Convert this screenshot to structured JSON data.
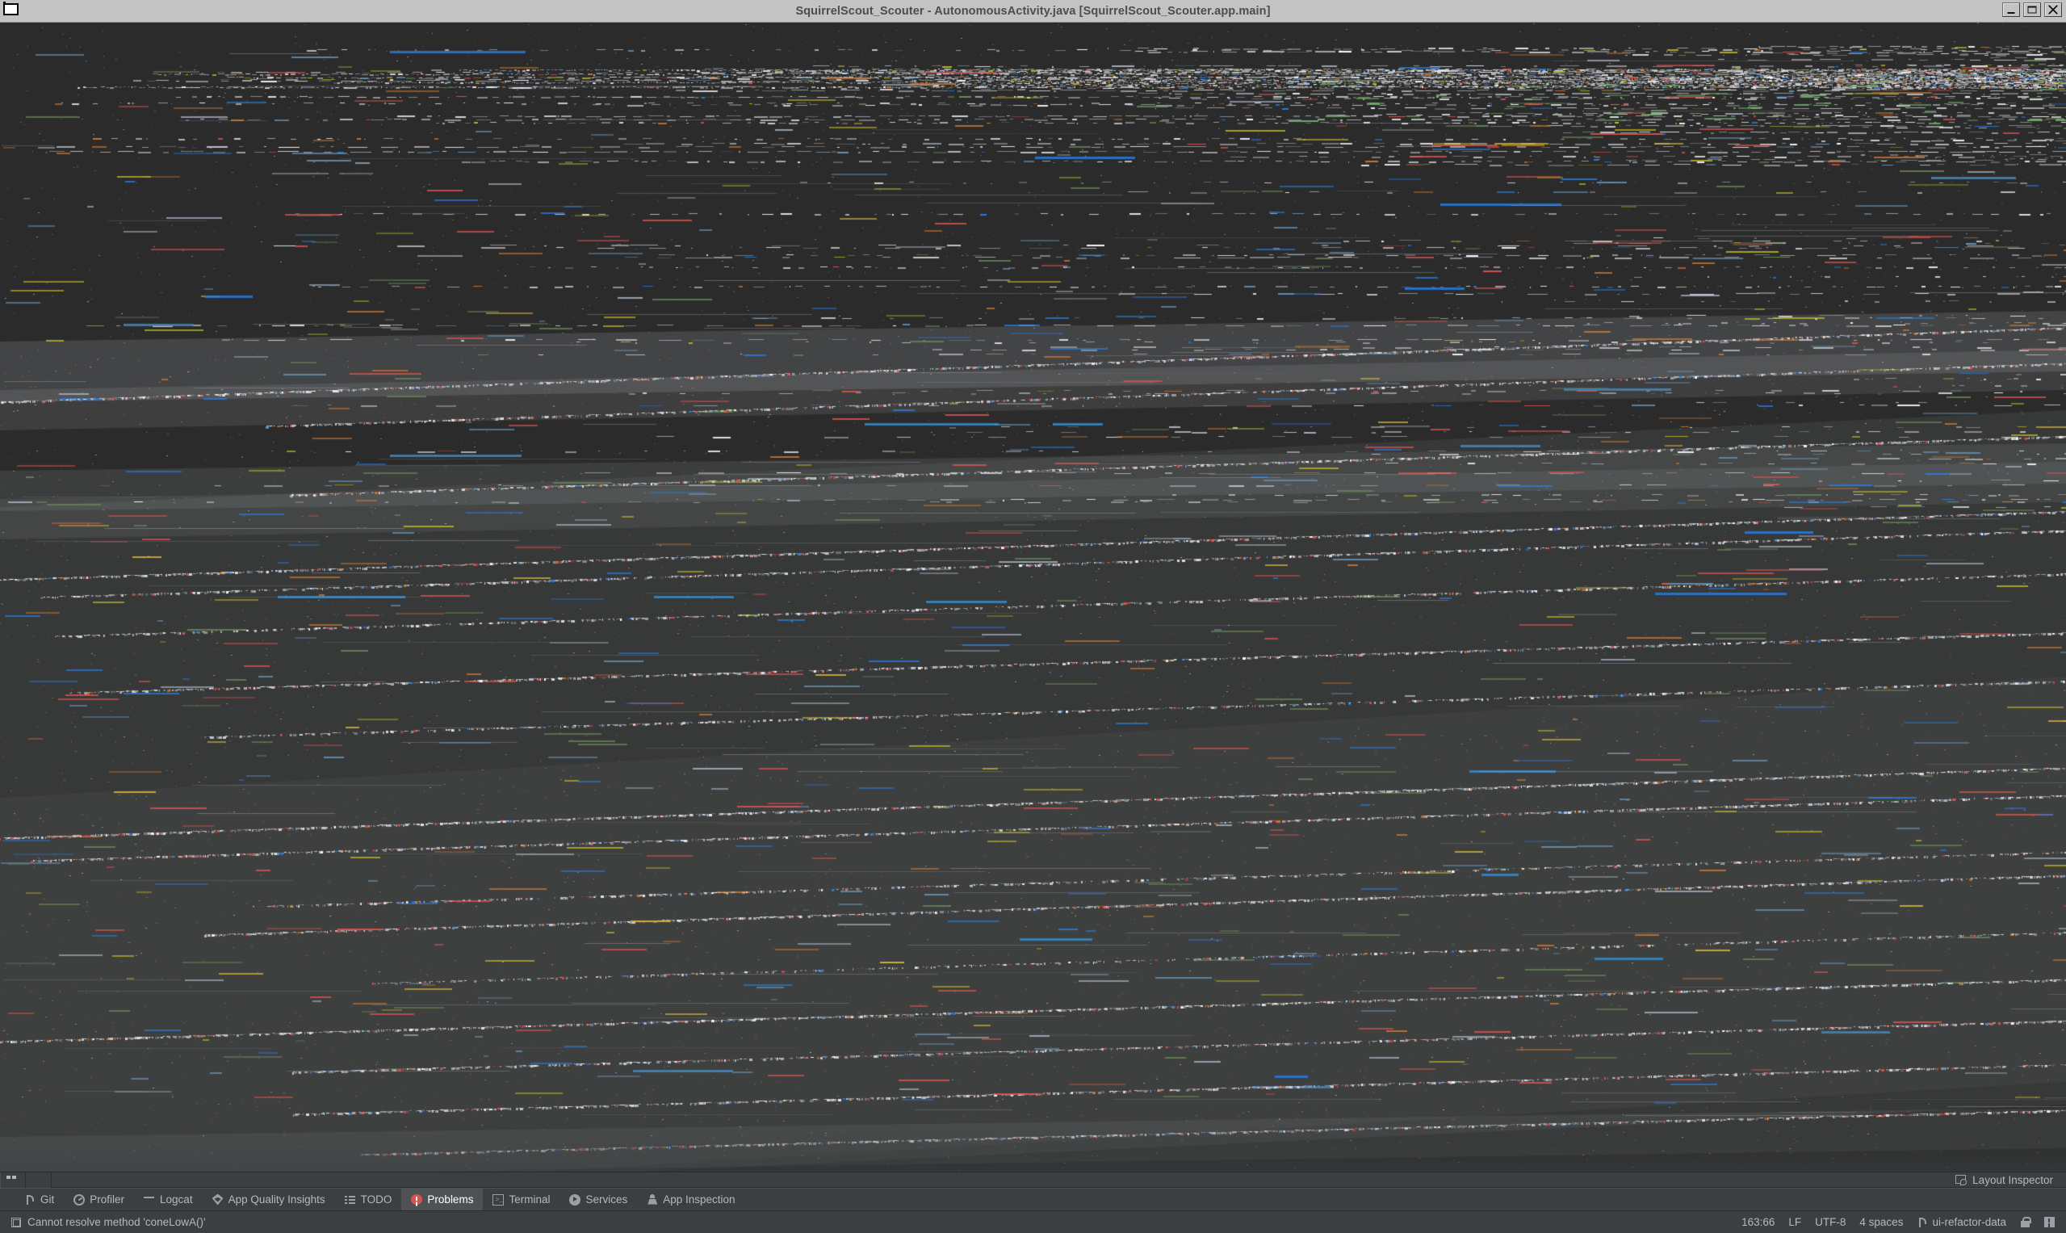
{
  "window": {
    "title": "SquirrelScout_Scouter - AutonomousActivity.java [SquirrelScout_Scouter.app.main]",
    "system_menu_icon": "window-system-menu-icon",
    "controls": [
      {
        "name": "minimize",
        "icon": "minimize-icon",
        "label": "_"
      },
      {
        "name": "maximize",
        "icon": "maximize-icon",
        "label": "□"
      },
      {
        "name": "close",
        "icon": "close-icon",
        "label": "×"
      }
    ]
  },
  "main_area": {
    "description": "Corrupted / glitched editor rendering",
    "background_color": "#2f3032",
    "editor_background": "#2b2b2b",
    "glitch_band_color": "#6e7173",
    "accent_colors": [
      "#a9b7c6",
      "#cc7832",
      "#6a8759",
      "#6897bb",
      "#bbb529",
      "#d9534f",
      "#287bde"
    ]
  },
  "mini_tabs": [
    {
      "name": "collapsed-tool-tab",
      "icon": "dots-icon"
    },
    {
      "name": "collapsed-tool-tab-2",
      "icon": "blank-icon"
    }
  ],
  "toolbar": {
    "tabs": [
      {
        "id": "git",
        "label": "Git",
        "icon": "branch-icon",
        "active": false
      },
      {
        "id": "profiler",
        "label": "Profiler",
        "icon": "gauge-icon",
        "active": false
      },
      {
        "id": "logcat",
        "label": "Logcat",
        "icon": "lines-icon",
        "active": false
      },
      {
        "id": "app-quality-insights",
        "label": "App Quality Insights",
        "icon": "diamond-icon",
        "active": false
      },
      {
        "id": "todo",
        "label": "TODO",
        "icon": "list-icon",
        "active": false
      },
      {
        "id": "problems",
        "label": "Problems",
        "icon": "error-icon",
        "active": true
      },
      {
        "id": "terminal",
        "label": "Terminal",
        "icon": "terminal-icon",
        "active": false
      },
      {
        "id": "services",
        "label": "Services",
        "icon": "play-icon",
        "active": false
      },
      {
        "id": "app-inspection",
        "label": "App Inspection",
        "icon": "inspect-icon",
        "active": false
      }
    ],
    "active_tab_bg": "#4e5254",
    "error_color": "#d9534f"
  },
  "layout_inspector": {
    "label": "Layout Inspector",
    "icon": "layout-inspector-icon"
  },
  "statusbar": {
    "message": "Cannot resolve method 'coneLowA()'",
    "message_icon": "memo-icon",
    "caret_position": "163:66",
    "line_separator": "LF",
    "encoding": "UTF-8",
    "indent": "4 spaces",
    "branch": "ui-refactor-data",
    "branch_icon": "branch-icon",
    "lock_icon": "lock-icon",
    "notification_icon": "notification-icon"
  }
}
